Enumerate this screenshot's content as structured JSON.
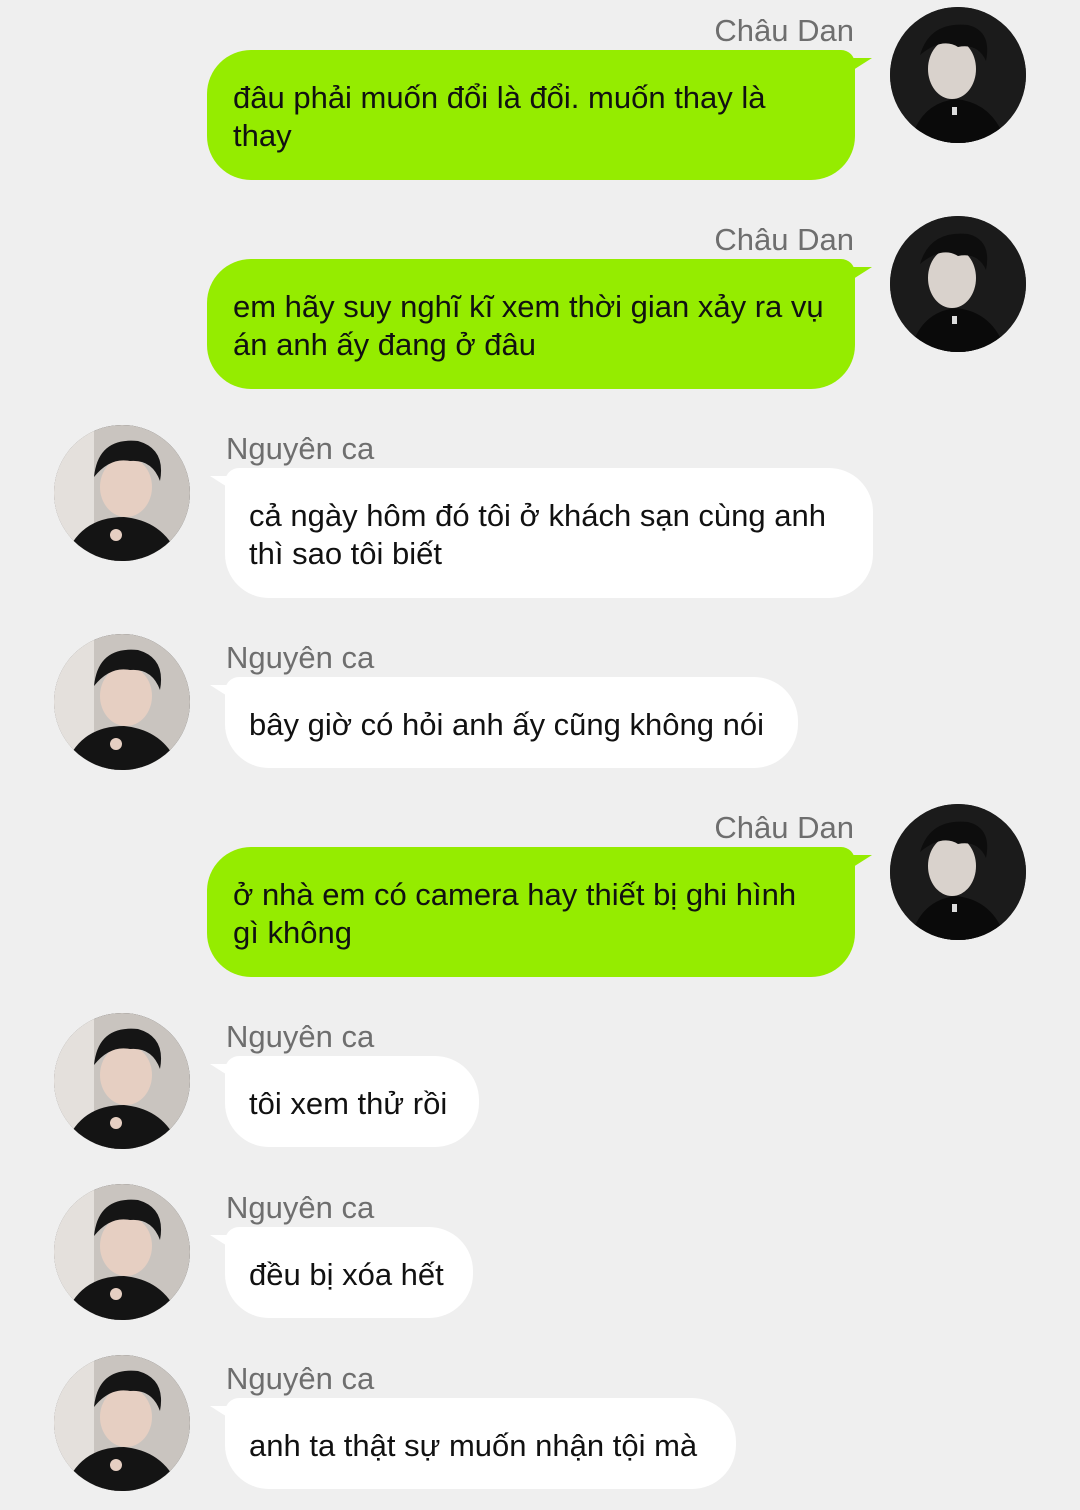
{
  "chat": {
    "messages": [
      {
        "sender": "Châu Dan",
        "side": "out",
        "text": "đâu phải muốn đổi là đổi. muốn thay là thay",
        "avatar": "user-avatar-chau-dan"
      },
      {
        "sender": "Châu Dan",
        "side": "out",
        "text": "em hãy suy nghĩ kĩ xem thời gian xảy ra vụ án anh ấy đang ở đâu",
        "avatar": "user-avatar-chau-dan"
      },
      {
        "sender": "Nguyên ca",
        "side": "in",
        "text": "cả ngày hôm đó tôi ở khách sạn cùng anh thì sao tôi biết",
        "avatar": "user-avatar-nguyen-ca"
      },
      {
        "sender": "Nguyên ca",
        "side": "in",
        "text": "bây giờ có hỏi anh ấy cũng không nói",
        "avatar": "user-avatar-nguyen-ca"
      },
      {
        "sender": "Châu Dan",
        "side": "out",
        "text": "ở nhà em có camera hay thiết bị ghi hình gì không",
        "avatar": "user-avatar-chau-dan"
      },
      {
        "sender": "Nguyên ca",
        "side": "in",
        "text": "tôi xem thử rồi",
        "avatar": "user-avatar-nguyen-ca"
      },
      {
        "sender": "Nguyên ca",
        "side": "in",
        "text": "đều bị xóa hết",
        "avatar": "user-avatar-nguyen-ca"
      },
      {
        "sender": "Nguyên ca",
        "side": "in",
        "text": "anh ta thật sự muốn nhận tội mà",
        "avatar": "user-avatar-nguyen-ca"
      }
    ]
  },
  "colors": {
    "background": "#efefef",
    "outgoing_bubble": "#95ec00",
    "incoming_bubble": "#ffffff",
    "name_text": "#6e6e6e",
    "message_text": "#111111"
  }
}
